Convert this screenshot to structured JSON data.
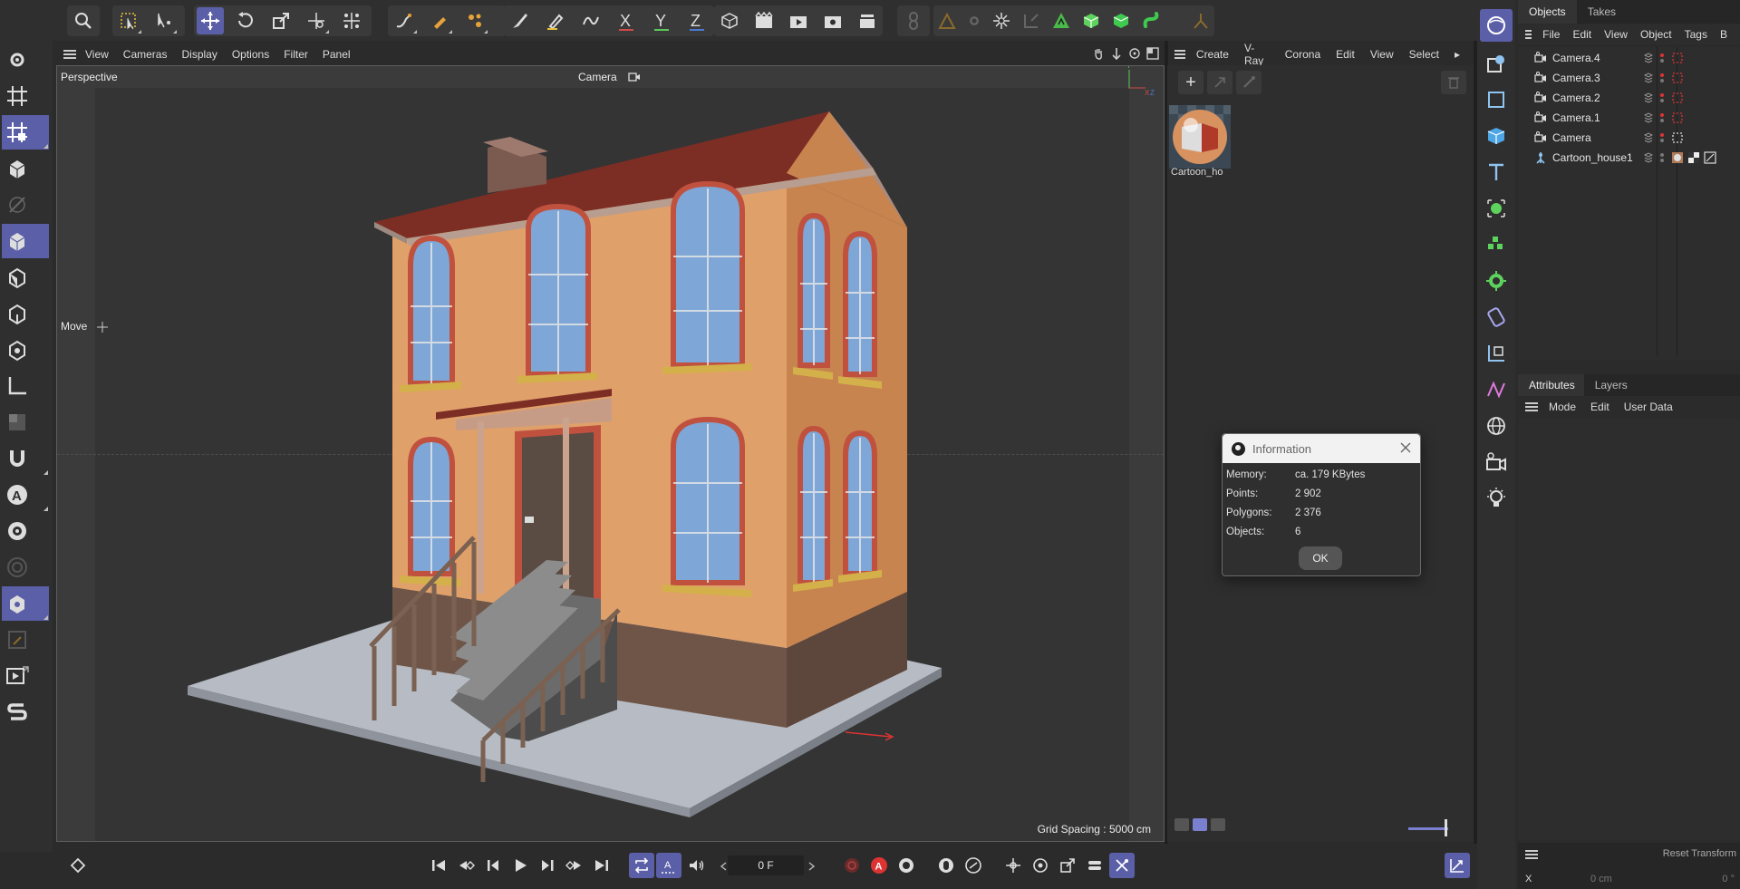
{
  "viewport": {
    "menu": [
      "View",
      "Cameras",
      "Display",
      "Options",
      "Filter",
      "Panel"
    ],
    "label": "Perspective",
    "camera": "Camera",
    "move_hint": "Move",
    "grid_spacing": "Grid Spacing : 5000 cm"
  },
  "material_manager": {
    "menu": [
      "Create",
      "V-Ray",
      "Corona",
      "Edit",
      "View",
      "Select"
    ],
    "materials": [
      {
        "name": "Cartoon_ho"
      }
    ]
  },
  "info_dialog": {
    "title": "Information",
    "rows": [
      {
        "key": "Memory:",
        "value": "ca. 179 KBytes"
      },
      {
        "key": "Points:",
        "value": "2 902"
      },
      {
        "key": "Polygons:",
        "value": "2 376"
      },
      {
        "key": "Objects:",
        "value": "6"
      }
    ],
    "ok_label": "OK"
  },
  "objects_panel": {
    "tabs": [
      "Objects",
      "Takes"
    ],
    "menu": [
      "File",
      "Edit",
      "View",
      "Object",
      "Tags",
      "B"
    ],
    "objects": [
      {
        "name": "Camera.4",
        "icon": "camera-icon"
      },
      {
        "name": "Camera.3",
        "icon": "camera-icon"
      },
      {
        "name": "Camera.2",
        "icon": "camera-icon"
      },
      {
        "name": "Camera.1",
        "icon": "camera-icon"
      },
      {
        "name": "Camera",
        "icon": "camera-icon"
      },
      {
        "name": "Cartoon_house1",
        "icon": "null-object-icon"
      }
    ]
  },
  "attributes_panel": {
    "tabs": [
      "Attributes",
      "Layers"
    ],
    "menu": [
      "Mode",
      "Edit",
      "User Data"
    ]
  },
  "coordinates": {
    "reset_label": "Reset Transform",
    "x_label": "X",
    "x_pos": "0 cm",
    "x_rot": "0 °"
  },
  "timeline": {
    "current_frame": "0 F"
  },
  "colors": {
    "accent": "#5a5fa8",
    "panel": "#2f2f2f",
    "viewport_bg": "#343434"
  }
}
